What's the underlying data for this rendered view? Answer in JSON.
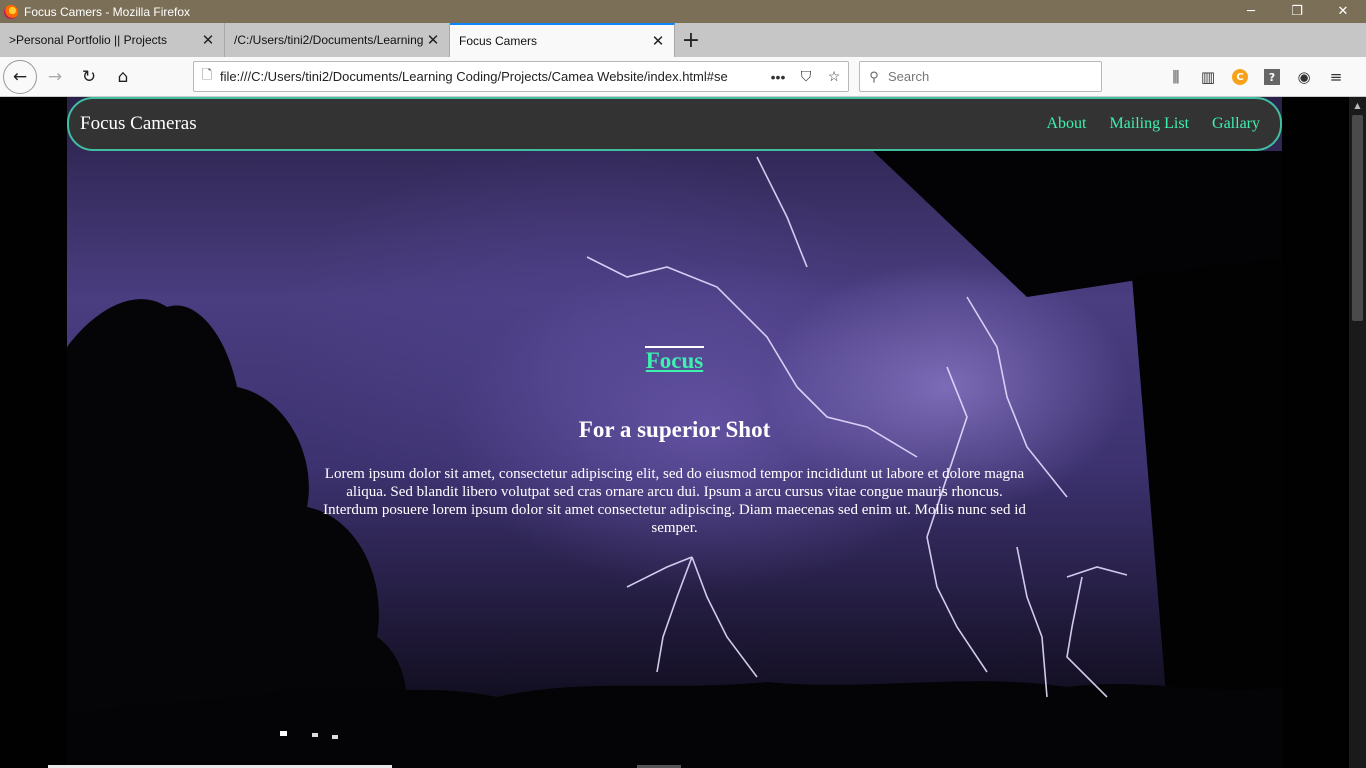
{
  "window": {
    "title": "Focus Camers - Mozilla Firefox",
    "controls": {
      "minimize": "─",
      "restore": "❐",
      "close": "✕"
    }
  },
  "tabs": [
    {
      "label": ">Personal Portfolio || Projects",
      "active": false
    },
    {
      "label": "/C:/Users/tini2/Documents/Learning",
      "active": false
    },
    {
      "label": "Focus Camers",
      "active": true
    }
  ],
  "toolbar": {
    "url": "file:///C:/Users/tini2/Documents/Learning Coding/Projects/Camea Website/index.html#se",
    "search_placeholder": "Search"
  },
  "site": {
    "brand": "Focus Cameras",
    "nav": [
      "About",
      "Mailing List",
      "Gallary"
    ],
    "hero_title": "Focus",
    "hero_subtitle": "For a superior Shot",
    "hero_paragraph": "Lorem ipsum dolor sit amet, consectetur adipiscing elit, sed do eiusmod tempor incididunt ut labore et dolore magna aliqua. Sed blandit libero volutpat sed cras ornare arcu dui. Ipsum a arcu cursus vitae congue mauris rhoncus. Interdum posuere lorem ipsum dolor sit amet consectetur adipiscing. Diam maecenas sed enim ut. Mollis nunc sed id semper."
  },
  "colors": {
    "accent": "#3ef0b0",
    "nav_border": "#3fbf9f",
    "nav_background": "#333333"
  }
}
